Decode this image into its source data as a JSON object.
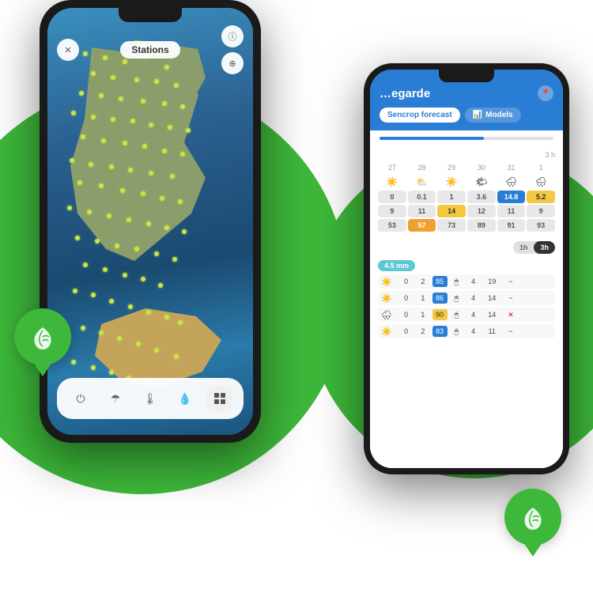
{
  "background": {
    "circleColor": "#3db83a"
  },
  "phoneLeft": {
    "title": "Stations",
    "closeBtn": "✕",
    "infoBtn": "ⓘ",
    "settingsBtn": "⊕",
    "toolbar": {
      "power": "⏻",
      "rain": "☂",
      "temp": "🌡",
      "drop": "💧",
      "grid": "⊞"
    }
  },
  "phoneRight": {
    "location": "...egarde",
    "locationFull": "Bellegarde",
    "tabs": [
      {
        "label": "Sencrop forecast",
        "active": true
      },
      {
        "label": "Models",
        "active": false,
        "icon": "📊"
      }
    ],
    "calHeader": [
      "27",
      "28",
      "29",
      "30",
      "31",
      "1"
    ],
    "calRows": [
      {
        "cells": [
          {
            "val": "0",
            "style": "gray"
          },
          {
            "val": "0.1",
            "style": "gray"
          },
          {
            "val": "1",
            "style": "gray"
          },
          {
            "val": "3.6",
            "style": "gray"
          },
          {
            "val": "14.8",
            "style": "blue"
          },
          {
            "val": "5.2",
            "style": "yellow"
          }
        ]
      },
      {
        "cells": [
          {
            "val": "9",
            "style": "gray"
          },
          {
            "val": "11",
            "style": "gray"
          },
          {
            "val": "14",
            "style": "yellow"
          },
          {
            "val": "12",
            "style": "gray"
          },
          {
            "val": "11",
            "style": "gray"
          },
          {
            "val": "9",
            "style": "gray"
          }
        ]
      },
      {
        "cells": [
          {
            "val": "53",
            "style": "gray"
          },
          {
            "val": "57",
            "style": "orange"
          },
          {
            "val": "73",
            "style": "gray"
          },
          {
            "val": "89",
            "style": "gray"
          },
          {
            "val": "91",
            "style": "gray"
          },
          {
            "val": "93",
            "style": "gray"
          }
        ]
      }
    ],
    "toggleOptions": [
      "1h",
      "3h"
    ],
    "toggleSelected": "3h",
    "rainLabel": "4.5 mm",
    "lowerRows": [
      {
        "icon": "☀️",
        "vals": [
          "0",
          "2",
          "85",
          "🖱",
          "4",
          "19",
          "~"
        ]
      },
      {
        "icon": "☀️",
        "vals": [
          "0",
          "1",
          "86",
          "🖱",
          "4",
          "14",
          "~"
        ]
      },
      {
        "icon": "🌧",
        "vals": [
          "0",
          "1",
          "90",
          "🖱",
          "4",
          "14",
          "✕"
        ]
      },
      {
        "icon": "☀️",
        "vals": [
          "0",
          "2",
          "83",
          "🖱",
          "4",
          "11",
          "~"
        ]
      }
    ]
  },
  "badges": [
    {
      "position": "left",
      "label": "sencrop-logo-left"
    },
    {
      "position": "right",
      "label": "sencrop-logo-right"
    }
  ]
}
